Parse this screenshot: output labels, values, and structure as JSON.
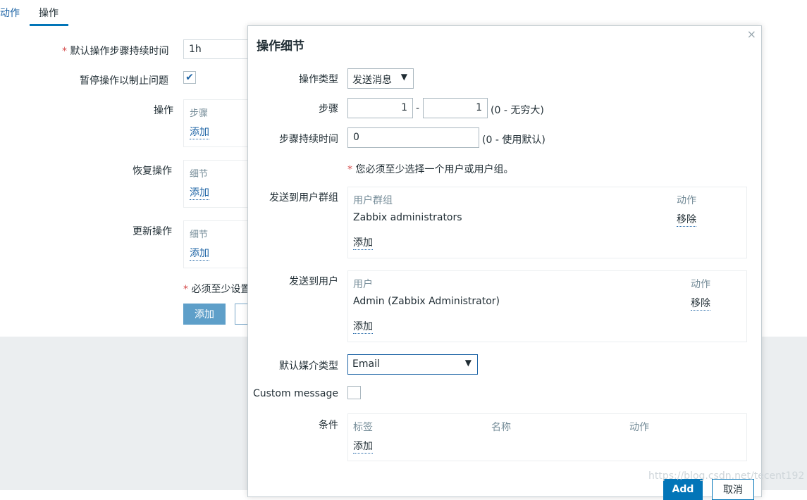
{
  "tabs": [
    {
      "label": "动作"
    },
    {
      "label": "操作"
    }
  ],
  "background_form": {
    "step_duration_label": "默认操作步骤持续时间",
    "step_duration_value": "1h",
    "pause_label": "暂停操作以制止问题",
    "operations_label": "操作",
    "operations_header": "步骤",
    "recovery_label": "恢复操作",
    "recovery_header": "细节",
    "update_label": "更新操作",
    "update_header": "细节",
    "add_link": "添加",
    "required_note": "必须至少设置",
    "add_button": "添加",
    "required_star": "*",
    "checkmark": "✔"
  },
  "dialog": {
    "title": "操作细节",
    "close_glyph": "×",
    "operation_type_label": "操作类型",
    "operation_type_value": "发送消息",
    "steps_label": "步骤",
    "step_from": "1",
    "step_to": "1",
    "step_separator": "-",
    "steps_hint": "(0 - 无穷大)",
    "step_duration_label": "步骤持续时间",
    "step_duration_value": "0",
    "step_duration_hint": "(0 - 使用默认)",
    "required_star": "*",
    "required_note": "您必须至少选择一个用户或用户组。",
    "user_groups": {
      "label": "发送到用户群组",
      "col_name": "用户群组",
      "col_action": "动作",
      "rows": [
        {
          "name": "Zabbix administrators",
          "action": "移除"
        }
      ],
      "add": "添加"
    },
    "users": {
      "label": "发送到用户",
      "col_name": "用户",
      "col_action": "动作",
      "rows": [
        {
          "name": "Admin (Zabbix Administrator)",
          "action": "移除"
        }
      ],
      "add": "添加"
    },
    "media_type_label": "默认媒介类型",
    "media_type_value": "Email",
    "custom_message_label": "Custom message",
    "conditions": {
      "label": "条件",
      "col_label": "标签",
      "col_name": "名称",
      "col_action": "动作",
      "add": "添加"
    },
    "add_button": "Add",
    "cancel_button": "取消",
    "dropdown_arrow": "▼"
  },
  "watermark": "https://blog.csdn.net/tecent192"
}
